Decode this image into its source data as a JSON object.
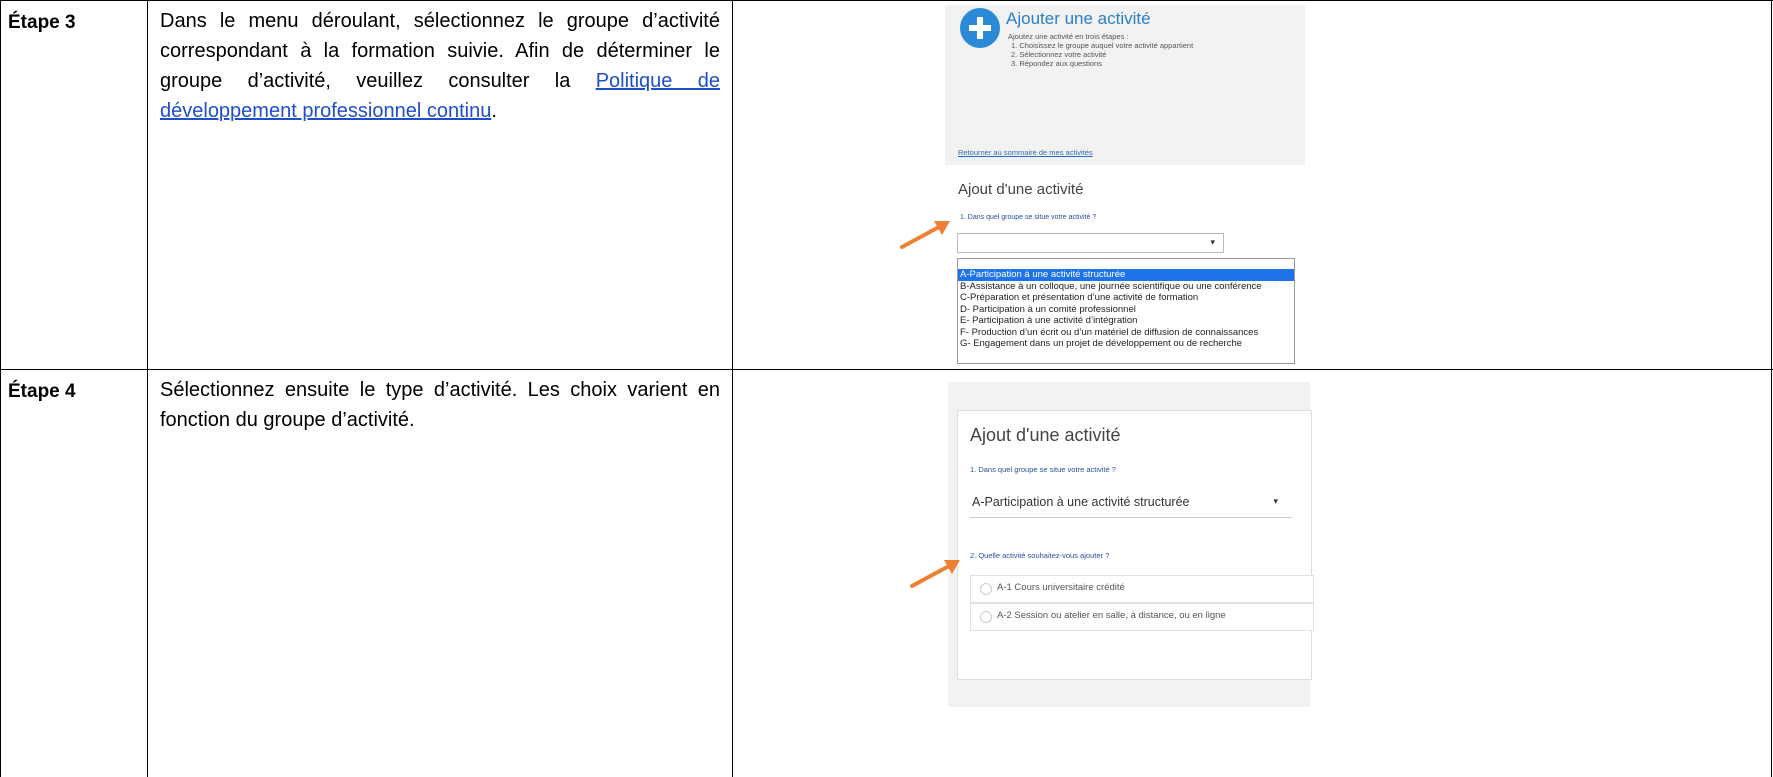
{
  "steps": [
    {
      "label": "Étape 3",
      "text_before_link": "Dans le menu déroulant, sélectionnez le groupe d’activité correspondant à la formation suivie. Afin de déterminer le groupe d’activité, veuillez consulter la ",
      "link_text": "Politique de développement professionnel continu",
      "text_after_link": "."
    },
    {
      "label": "Étape 4",
      "text": "Sélectionnez ensuite le type d’activité. Les choix varient en fonction du groupe d’activité."
    }
  ],
  "screenshot1": {
    "title": "Ajouter une activité",
    "intro": "Ajoutez une activité en trois étapes :",
    "steps": [
      "1. Choisissez le groupe auquel votre activité appartient",
      "2. Sélectionnez votre activité",
      "3. Répondez aux questions"
    ],
    "return_link": "Retourner au sommaire de mes activités",
    "heading": "Ajout d'une activité",
    "question": "1. Dans quel groupe se situe votre activité ?",
    "selected_value": "",
    "options": [
      "A-Participation à une activité structurée",
      "B-Assistance à un colloque, une journée scientifique ou une conférence",
      "C-Préparation et présentation d’une activité de formation",
      "D- Participation à un comité professionnel",
      "E- Participation à une activité d’intégration",
      "F- Production d’un écrit ou d’un matériel de diffusion de connaissances",
      "G- Engagement dans un projet de développement ou de recherche"
    ],
    "highlighted_option": "A-Participation à une activité structurée"
  },
  "screenshot2": {
    "heading": "Ajout d'une activité",
    "question1": "1. Dans quel groupe se situe votre activité ?",
    "selected_value": "A-Participation à une activité structurée",
    "question2": "2. Quelle activité souhaitez-vous ajouter ?",
    "activity_options": [
      "A-1 Cours universitaire crédité",
      "A-2 Session ou atelier en salle, à distance, ou en ligne"
    ]
  },
  "colors": {
    "link": "#1f4ec9",
    "arrow": "#ee8033",
    "accent_blue": "#2a8ad8",
    "selection": "#1e73e8"
  }
}
